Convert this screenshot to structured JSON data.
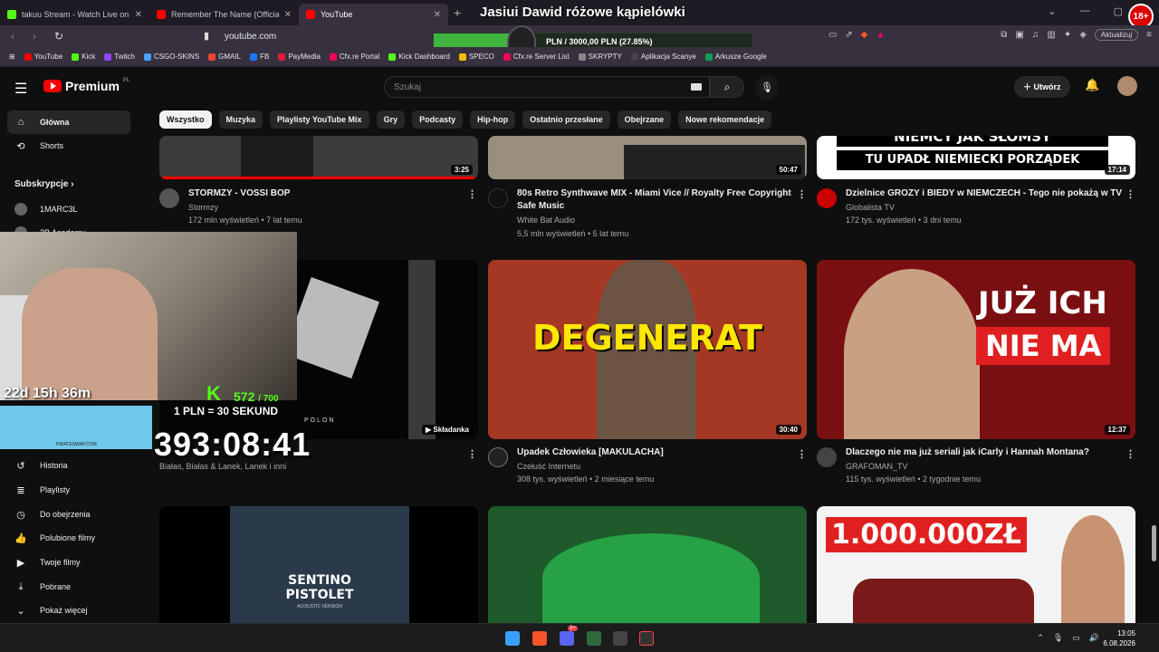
{
  "browser": {
    "tabs": [
      {
        "title": "takuu Stream - Watch Live on Kick",
        "color": "#53fc18"
      },
      {
        "title": "Remember The Name (Official Video)",
        "color": "#ff0000"
      },
      {
        "title": "YouTube",
        "color": "#ff0000"
      }
    ],
    "url": "youtube.com",
    "update_label": "Aktualizuj",
    "bookmarks": [
      {
        "label": "YouTube",
        "color": "#ff0000"
      },
      {
        "label": "Kick",
        "color": "#53fc18"
      },
      {
        "label": "Twitch",
        "color": "#9146ff"
      },
      {
        "label": "CSGO-SKINS",
        "color": "#4aa3ff"
      },
      {
        "label": "GMAIL",
        "color": "#ea4335"
      },
      {
        "label": "FB",
        "color": "#1877f2"
      },
      {
        "label": "PayMedia",
        "color": "#e21b3c"
      },
      {
        "label": "Cfx.re Portal",
        "color": "#f40552"
      },
      {
        "label": "Kick Dashboard",
        "color": "#53fc18"
      },
      {
        "label": "SPECO",
        "color": "#f0c000"
      },
      {
        "label": "Cfx.re Server List",
        "color": "#f40552"
      },
      {
        "label": "SKRYPTY",
        "color": "#888888"
      },
      {
        "label": "Aplikacja Scanye",
        "color": "#444444"
      },
      {
        "label": "Arkusze Google",
        "color": "#0f9d58"
      }
    ]
  },
  "overlay": {
    "stream_title": "Jasiui Dawid różowe kąpielówki",
    "donation_text": "PLN / 3000,00 PLN  (27.85%)",
    "donation_progress": 0.2785,
    "age_badge": "18+",
    "timer_small": "22d 15h 36m",
    "kick_count": "572",
    "kick_goal": "/ 700",
    "kick_letter": "K",
    "rate": "1 PLN = 30 SEKUND",
    "timer_big": "393:08:41",
    "ad_label": "PIRATESWAP.COM"
  },
  "yt": {
    "logo": "Premium",
    "logo_sup": "PL",
    "search_placeholder": "Szukaj",
    "create_label": "Utwórz",
    "chips": [
      "Wszystko",
      "Muzyka",
      "Playlisty YouTube Mix",
      "Gry",
      "Podcasty",
      "Hip-hop",
      "Ostatnio przesłane",
      "Obejrzane",
      "Nowe rekomendacje"
    ],
    "sidebar": {
      "home": "Główna",
      "shorts": "Shorts",
      "subs_header": "Subskrypcje",
      "sub1": "1MARC3L",
      "sub2": "2B Academy",
      "history": "Historia",
      "playlists": "Playlisty",
      "watch_later": "Do obejrzenia",
      "liked": "Polubione filmy",
      "your_videos": "Twoje filmy",
      "downloads": "Pobrane",
      "show_more": "Pokaż więcej"
    },
    "videos": [
      {
        "title": "STORMZY - VOSSI BOP",
        "channel": "Stormzy",
        "meta": "172 mln wyświetleń • 7 lat temu",
        "duration": "3:25"
      },
      {
        "title": "80s Retro Synthwave MIX - Miami Vice // Royalty Free Copyright Safe Music",
        "channel": "White Bat Audio",
        "meta": "5,5 mln wyświetleń • 5 lat temu",
        "duration": "50:47"
      },
      {
        "title": "Dzielnice GROZY i BIEDY w NIEMCZECH - Tego nie pokażą w TV",
        "channel": "Globalista TV",
        "meta": "172 tys. wyświetleń • 3 dni temu",
        "duration": "17:14",
        "thumb_line1": "NIEMCY JAK SŁOMSY",
        "thumb_line2": "TU UPADŁ NIEMIECKI PORZĄDEK"
      },
      {
        "title": "",
        "channel": "Białas, Białas & Lanek, Lanek i inni",
        "meta": "",
        "duration": "Składanka",
        "thumb_text": "POLON"
      },
      {
        "title": "Upadek Człowieka [MAKULACHA]",
        "channel": "Czełuść Internetu",
        "meta": "308 tys. wyświetleń • 2 miesiące temu",
        "duration": "30:40",
        "thumb_text": "DEGENERAT"
      },
      {
        "title": "Dlaczego nie ma już seriali jak iCarly i Hannah Montana?",
        "channel": "GRAFOMAN_TV",
        "meta": "115 tys. wyświetleń • 2 tygodnie temu",
        "duration": "12:37",
        "thumb_line1": "JUŻ ICH",
        "thumb_line2": "NIE MA"
      },
      {
        "thumb_line1": "SENTINO",
        "thumb_line2": "PISTOLET",
        "thumb_line3": "ACOUSTIC VERSION"
      },
      {},
      {
        "thumb_text": "1.000.000ZŁ"
      }
    ]
  },
  "taskbar": {
    "time": "13:05",
    "date": "6.08.2026",
    "discord_badge": "9+"
  }
}
